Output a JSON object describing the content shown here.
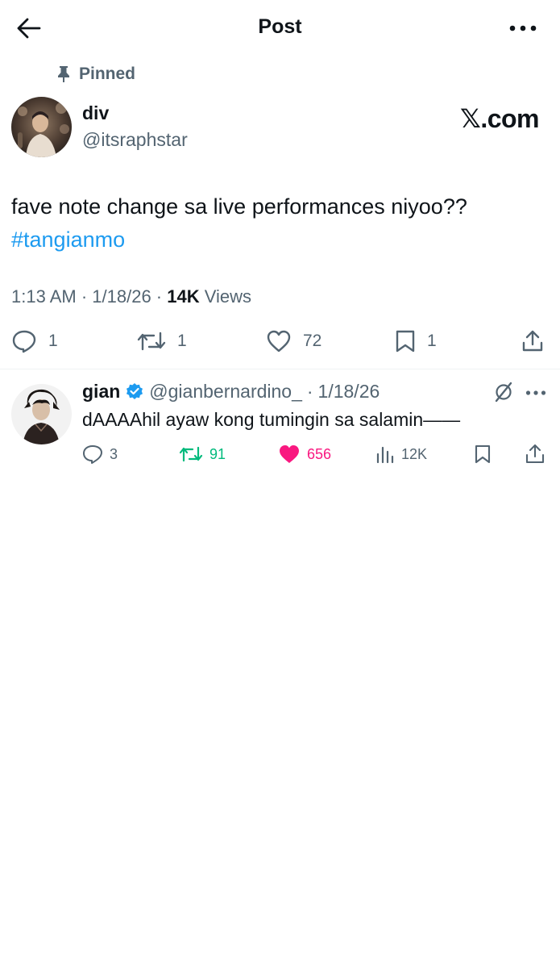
{
  "header": {
    "title": "Post",
    "back_icon": "arrow-left-icon",
    "more_icon": "ellipsis-icon"
  },
  "pinned": {
    "label": "Pinned",
    "icon": "pin-icon"
  },
  "tweet": {
    "author_name": "div",
    "author_handle": "@itsraphstar",
    "watermark": "𝕏.com",
    "text": "fave note change sa live performances niyoo??",
    "hashtag": "#tangianmo",
    "time": "1:13 AM",
    "sep1": " · ",
    "date": "1/18/26",
    "sep2": " · ",
    "views_count": "14K",
    "views_label": " Views",
    "stats": {
      "replies": "1",
      "reposts": "1",
      "likes": "72",
      "bookmarks": "1"
    }
  },
  "reply": {
    "author_name": "gian",
    "author_handle": "@gianbernardino_",
    "sep": "·",
    "date": "1/18/26",
    "text": "dAAAAhil ayaw kong tumingin sa salamin——",
    "stats": {
      "replies": "3",
      "reposts": "91",
      "likes": "656",
      "views": "12K"
    },
    "verified": true
  },
  "colors": {
    "text_primary": "#0f1419",
    "text_secondary": "#536471",
    "link": "#1d9bf0",
    "repost_active": "#00ba7c",
    "like_active": "#f91880",
    "verified": "#1d9bf0",
    "divider": "#eff3f4"
  }
}
